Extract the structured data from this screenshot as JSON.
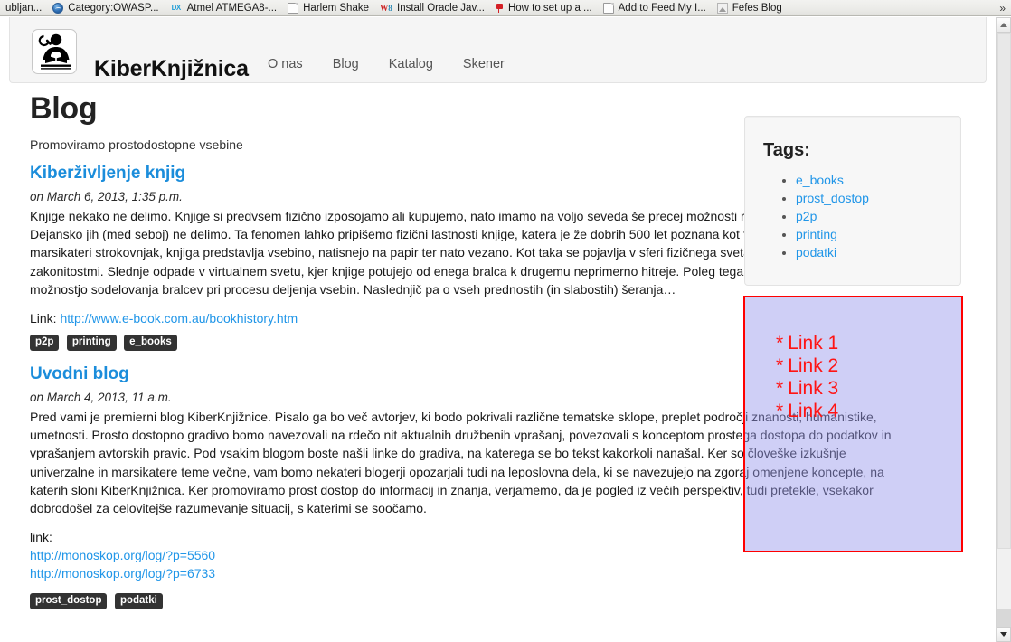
{
  "browser": {
    "bookmarks": [
      {
        "label": "ubljan...",
        "icon": "none"
      },
      {
        "label": "Category:OWASP...",
        "icon": "globe-icon"
      },
      {
        "label": "Atmel ATMEGA8-...",
        "icon": "dx-icon"
      },
      {
        "label": "Harlem Shake",
        "icon": "document-icon"
      },
      {
        "label": "Install Oracle Jav...",
        "icon": "w8-icon"
      },
      {
        "label": "How to set up a ...",
        "icon": "red-flag-icon"
      },
      {
        "label": "Add to Feed My I...",
        "icon": "document-icon"
      },
      {
        "label": "Fefes Blog",
        "icon": "picture-icon"
      }
    ],
    "overflow_label": "»"
  },
  "navbar": {
    "brand": "KiberKnjižnica",
    "logo_icon": "library-reader-icon",
    "links": [
      {
        "label": "O nas"
      },
      {
        "label": "Blog"
      },
      {
        "label": "Katalog"
      },
      {
        "label": "Skener"
      }
    ]
  },
  "main": {
    "page_title": "Blog",
    "tagline": "Promoviramo prostodostopne vsebine",
    "posts": [
      {
        "title": "Kiberživljenje knjig",
        "date": "on March 6, 2013, 1:35 p.m.",
        "body": "Knjige nekako ne delimo. Knjige si predvsem fizično izposojamo ali kupujemo, nato imamo na voljo seveda še precej možnosti razmnoževanja vsebine. Dejansko jih (med seboj) ne delimo. Ta fenomen lahko pripišemo fizični lastnosti knjige, katera je že dobrih 500 let poznana kot fizični medij. Kot je pojasnil že marsikateri strokovnjak, knjiga predstavlja vsebino, natisnejo na papir ter nato vezano. Kot taka se pojavlja v sferi fizičnega sveta, ki je omejen s svojimi zakonitostmi. Slednje odpade v virtualnem svetu, kjer knjige potujejo od enega bralca k drugemu neprimerno hitreje. Poleg tega ob sheranju opazimo večjo možnostjo sodelovanja bralcev pri procesu deljenja vsebin. Naslednjič pa o vseh prednostih (in slabostih) šeranja…",
        "link_label": "Link:",
        "link_url": "http://www.e-book.com.au/bookhistory.htm",
        "tags": [
          "p2p",
          "printing",
          "e_books"
        ]
      },
      {
        "title": "Uvodni blog",
        "date": "on March 4, 2013, 11 a.m.",
        "body": "Pred vami je premierni blog KiberKnjižnice. Pisalo ga bo več avtorjev, ki bodo pokrivali različne tematske sklope, preplet področji znanosti, humanistike, umetnosti. Prosto dostopno gradivo bomo navezovali na rdečo nit aktualnih družbenih vprašanj, povezovali s konceptom prostega dostopa do podatkov in vprašanjem avtorskih pravic. Pod vsakim blogom boste našli linke do gradiva, na katerega se bo tekst kakorkoli nanašal. Ker so človeške izkušnje univerzalne in marsikatere teme večne, vam bomo nekateri blogerji opozarjali tudi na leposlovna dela, ki se navezujejo na zgoraj omenjene koncepte, na katerih sloni KiberKnjižnica. Ker promoviramo prost dostop do informacij in znanja, verjamemo, da je pogled iz večih perspektiv, tudi pretekle, vsekakor dobrodošel za celovitejše razumevanje situacij, s katerimi se soočamo.",
        "link_label": "link:",
        "links": [
          "http://monoskop.org/log/?p=5560",
          "http://monoskop.org/log/?p=6733"
        ],
        "tags": [
          "prost_dostop",
          "podatki"
        ]
      }
    ]
  },
  "sidebar": {
    "tags_heading": "Tags:",
    "tags": [
      {
        "label": "e_books"
      },
      {
        "label": "prost_dostop"
      },
      {
        "label": "p2p"
      },
      {
        "label": "printing"
      },
      {
        "label": "podatki"
      }
    ]
  },
  "overlay": {
    "border_color": "#ff0000",
    "fill_color": "#9696eb",
    "text_color": "#ff1414",
    "links": [
      {
        "bullet": "*",
        "label": "Link 1"
      },
      {
        "bullet": "*",
        "label": "Link 2"
      },
      {
        "bullet": "*",
        "label": "Link 3"
      },
      {
        "bullet": "*",
        "label": "Link 4"
      }
    ]
  },
  "colors": {
    "link": "#2196e8",
    "heading": "#222222",
    "tag_badge_bg": "#333333",
    "navbar_bg": "#f5f5f5"
  }
}
